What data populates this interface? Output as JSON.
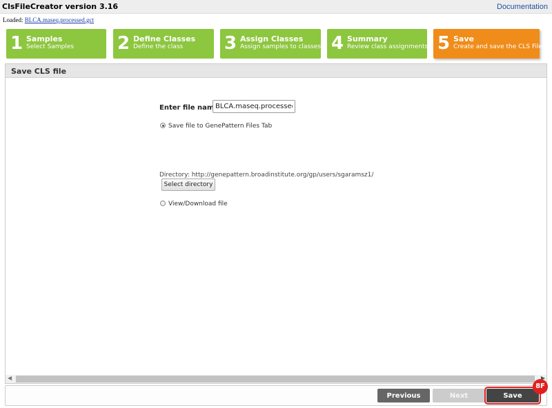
{
  "app": {
    "title": "ClsFileCreator version 3.16",
    "documentation_link": "Documentation"
  },
  "loaded": {
    "label": "Loaded:",
    "file": "BLCA.maseq.processed.gct"
  },
  "steps": [
    {
      "number": "1",
      "title": "Samples",
      "subtitle": "Select Samples",
      "active": false
    },
    {
      "number": "2",
      "title": "Define Classes",
      "subtitle": "Define the class",
      "active": false
    },
    {
      "number": "3",
      "title": "Assign Classes",
      "subtitle": "Assign samples to classes",
      "active": false
    },
    {
      "number": "4",
      "title": "Summary",
      "subtitle": "Review class assignments",
      "active": false
    },
    {
      "number": "5",
      "title": "Save",
      "subtitle": "Create and save the CLS File",
      "active": true
    }
  ],
  "panel": {
    "title": "Save CLS file"
  },
  "form": {
    "file_name_label": "Enter file name:",
    "file_name_value": "BLCA.maseq.processed.cls",
    "save_to_gp_label": "Save file to GenePattern Files Tab",
    "directory_text": "Directory: http://genepattern.broadinstitute.org/gp/users/sgaramsz1/",
    "select_directory_button": "Select directory",
    "view_download_label": "View/Download file",
    "selected_option": "save_to_gp"
  },
  "footer": {
    "previous_button": "Previous",
    "next_button": "Next",
    "save_button": "Save"
  },
  "annotation": {
    "badge": "8F"
  },
  "colors": {
    "step_green": "#8dc63f",
    "step_active_orange": "#f08c1a",
    "highlight_red": "#e02020"
  }
}
